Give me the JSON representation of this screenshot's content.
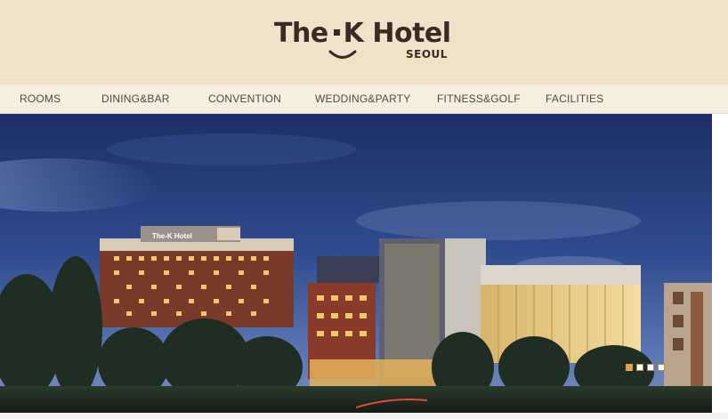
{
  "brand": {
    "title_part1": "The",
    "title_part2": "K",
    "title_part3": "Hotel",
    "subtitle": "SEOUL"
  },
  "nav": {
    "items": [
      {
        "label": "ROOMS"
      },
      {
        "label": "DINING&BAR"
      },
      {
        "label": "CONVENTION"
      },
      {
        "label": "WEDDING&PARTY"
      },
      {
        "label": "FITNESS&GOLF"
      },
      {
        "label": "FACILITIES"
      }
    ]
  },
  "hero": {
    "building_sign": "The-K Hotel",
    "slides_total": 4,
    "active_slide": 1
  },
  "colors": {
    "header_bg": "#efe2c8",
    "nav_bg": "#f6eee1",
    "brand_text": "#3a2a22",
    "nav_text": "#5a4636",
    "slider_active": "#e2a24a"
  }
}
